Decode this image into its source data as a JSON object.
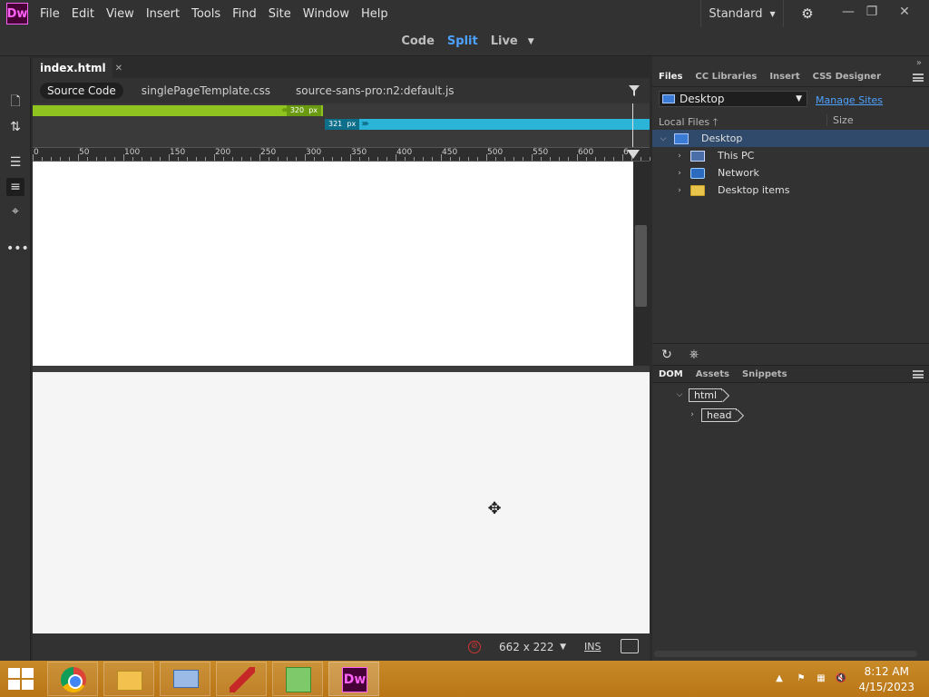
{
  "app": {
    "logo": "Dw",
    "menu": [
      "File",
      "Edit",
      "View",
      "Insert",
      "Tools",
      "Find",
      "Site",
      "Window",
      "Help"
    ],
    "workspace": "Standard",
    "window_controls": [
      "minimize-icon",
      "restore-icon",
      "close-icon"
    ]
  },
  "view_switcher": {
    "code": "Code",
    "split": "Split",
    "live": "Live",
    "active": "Split"
  },
  "document": {
    "tab_name": "index.html",
    "related_files": [
      "Source Code",
      "singlePageTemplate.css",
      "source-sans-pro:n2:default.js"
    ],
    "media_queries": {
      "max_label": "320",
      "min_label": "321",
      "unit": "px"
    },
    "ruler_labels": [
      "0",
      "50",
      "100",
      "150",
      "200",
      "250",
      "300",
      "350",
      "400",
      "450",
      "500",
      "550",
      "600",
      "6"
    ]
  },
  "status": {
    "window_size": "662 x 222",
    "mode": "INS"
  },
  "files_panel": {
    "tabs": [
      "Files",
      "CC Libraries",
      "Insert",
      "CSS Designer"
    ],
    "active_tab": "Files",
    "site": "Desktop",
    "manage_sites": "Manage Sites",
    "col_local": "Local Files",
    "col_size": "Size",
    "tree": [
      {
        "label": "Desktop",
        "icon": "monitor-icon",
        "expanded": true
      },
      {
        "label": "This PC",
        "icon": "pc-icon"
      },
      {
        "label": "Network",
        "icon": "network-icon"
      },
      {
        "label": "Desktop items",
        "icon": "folder-icon"
      }
    ]
  },
  "dom_panel": {
    "tabs": [
      "DOM",
      "Assets",
      "Snippets"
    ],
    "active_tab": "DOM",
    "nodes": [
      {
        "tag": "html",
        "expanded": true
      },
      {
        "tag": "head",
        "expanded": false
      }
    ]
  },
  "taskbar": {
    "apps": [
      "chrome-icon",
      "file-explorer-icon",
      "remote-desktop-icon",
      "feather-icon",
      "installer-icon",
      "dreamweaver-icon"
    ],
    "dw_label": "Dw",
    "time": "8:12 AM",
    "date": "4/15/2023"
  },
  "colors": {
    "accent": "#4da1ff",
    "mq_max": "#8fc31f",
    "mq_min": "#29b4d8",
    "taskbar": "#c0801f"
  }
}
